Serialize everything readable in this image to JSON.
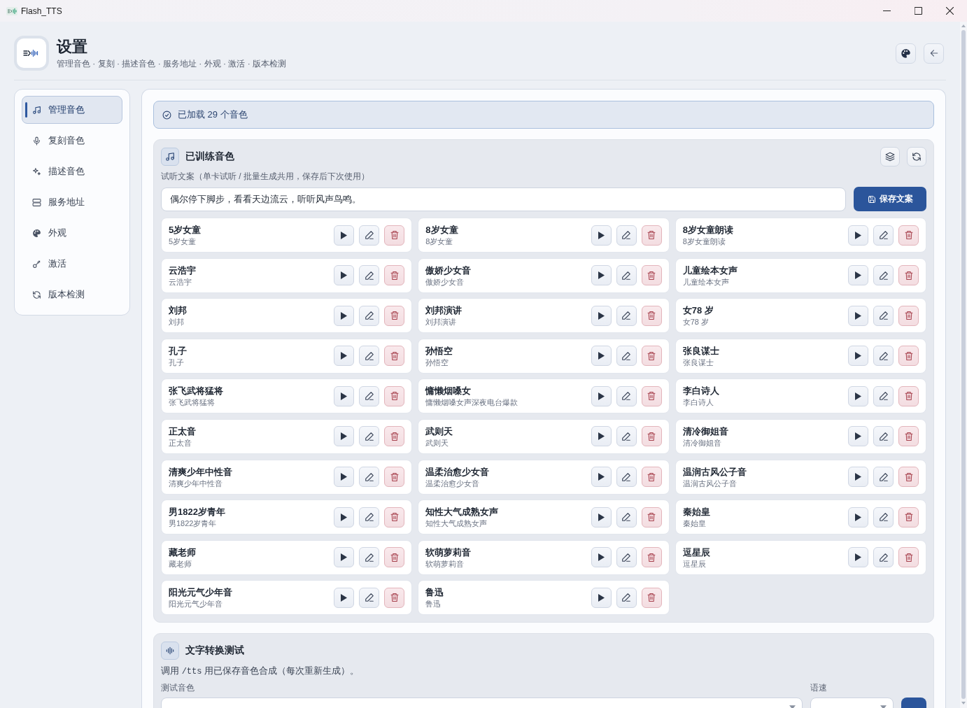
{
  "window": {
    "title": "Flash_TTS"
  },
  "header": {
    "title": "设置",
    "subtitle": "管理音色 · 复刻 · 描述音色 · 服务地址 · 外观 · 激活 · 版本检测"
  },
  "sidebar": {
    "items": [
      {
        "label": "管理音色",
        "selected": true
      },
      {
        "label": "复刻音色",
        "selected": false
      },
      {
        "label": "描述音色",
        "selected": false
      },
      {
        "label": "服务地址",
        "selected": false
      },
      {
        "label": "外观",
        "selected": false
      },
      {
        "label": "激活",
        "selected": false
      },
      {
        "label": "版本检测",
        "selected": false
      }
    ]
  },
  "status": {
    "text": "已加载 29 个音色"
  },
  "trained_voices": {
    "title": "已训练音色",
    "script_label": "试听文案（单卡试听 / 批量生成共用，保存后下次使用）",
    "script_text": "偶尔停下脚步，看看天边流云，听听风声鸟鸣。",
    "save_button": "保存文案",
    "voices": [
      {
        "name": "5岁女童",
        "description": "5岁女童"
      },
      {
        "name": "8岁女童",
        "description": "8岁女童"
      },
      {
        "name": "8岁女童朗读",
        "description": "8岁女童朗读"
      },
      {
        "name": "云浩宇",
        "description": "云浩宇"
      },
      {
        "name": "傲娇少女音",
        "description": "傲娇少女音"
      },
      {
        "name": "儿童绘本女声",
        "description": "儿童绘本女声"
      },
      {
        "name": "刘邦",
        "description": "刘邦"
      },
      {
        "name": "刘邦演讲",
        "description": "刘邦演讲"
      },
      {
        "name": "女78 岁",
        "description": "女78 岁"
      },
      {
        "name": "孔子",
        "description": "孔子"
      },
      {
        "name": "孙悟空",
        "description": "孙悟空"
      },
      {
        "name": "张良谋士",
        "description": "张良谋士"
      },
      {
        "name": "张飞武将猛将",
        "description": "张飞武将猛将"
      },
      {
        "name": "慵懒烟嗓女",
        "description": "慵懒烟嗓女声深夜电台爆款"
      },
      {
        "name": "李白诗人",
        "description": "李白诗人"
      },
      {
        "name": "正太音",
        "description": "正太音"
      },
      {
        "name": "武则天",
        "description": "武则天"
      },
      {
        "name": "清冷御姐音",
        "description": "清冷御姐音"
      },
      {
        "name": "清爽少年中性音",
        "description": "清爽少年中性音"
      },
      {
        "name": "温柔治愈少女音",
        "description": "温柔治愈少女音"
      },
      {
        "name": "温润古风公子音",
        "description": "温润古风公子音"
      },
      {
        "name": "男1822岁青年",
        "description": "男1822岁青年"
      },
      {
        "name": "知性大气成熟女声",
        "description": "知性大气成熟女声"
      },
      {
        "name": "秦始皇",
        "description": "秦始皇"
      },
      {
        "name": "藏老师",
        "description": "藏老师"
      },
      {
        "name": "软萌萝莉音",
        "description": "软萌萝莉音"
      },
      {
        "name": "逗星辰",
        "description": "逗星辰"
      },
      {
        "name": "阳光元气少年音",
        "description": "阳光元气少年音"
      },
      {
        "name": "鲁迅",
        "description": "鲁迅"
      }
    ]
  },
  "tts_test": {
    "title": "文字转换测试",
    "description": [
      {
        "kind": "text",
        "text": "调用 "
      },
      {
        "kind": "code",
        "text": "/tts"
      },
      {
        "kind": "text",
        "text": " 用已保存音色合成（每次重新生成）。"
      }
    ],
    "voice_label": "测试音色",
    "speed_label": "语速"
  }
}
